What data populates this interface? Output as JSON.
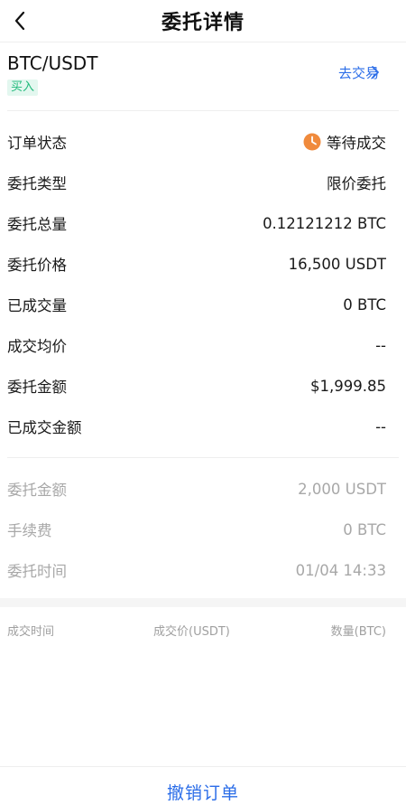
{
  "header": {
    "title": "委托详情",
    "back_icon": "chevron-left-icon"
  },
  "pair": {
    "symbol": "BTC/USDT",
    "side": "买入",
    "side_color": "#1fb97a",
    "trade_link": "去交易",
    "trade_link_color": "#2b6de8"
  },
  "details": [
    {
      "label": "订单状态",
      "value": "等待成交",
      "icon": "clock-icon",
      "icon_color": "#f08a3c"
    },
    {
      "label": "委托类型",
      "value": "限价委托"
    },
    {
      "label": "委托总量",
      "value": "0.12121212 BTC"
    },
    {
      "label": "委托价格",
      "value": "16,500 USDT"
    },
    {
      "label": "已成交量",
      "value": "0 BTC"
    },
    {
      "label": "成交均价",
      "value": "--"
    },
    {
      "label": "委托金额",
      "value": "$1,999.85"
    },
    {
      "label": "已成交金额",
      "value": "--"
    }
  ],
  "extra": [
    {
      "label": "委托金额",
      "value": "2,000 USDT"
    },
    {
      "label": "手续费",
      "value": "0 BTC"
    },
    {
      "label": "委托时间",
      "value": "01/04 14:33"
    }
  ],
  "trades": {
    "columns": [
      "成交时间",
      "成交价(USDT)",
      "数量(BTC)"
    ]
  },
  "actions": {
    "cancel_label": "撤销订单"
  }
}
